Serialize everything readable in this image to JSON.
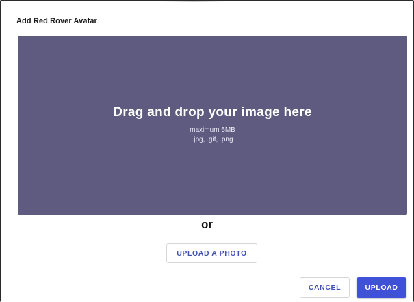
{
  "dialog": {
    "title": "Add Red Rover Avatar"
  },
  "dropzone": {
    "heading": "Drag and drop your image here",
    "max_size": "maximum 5MB",
    "file_types": ".jpg, .gif, .png",
    "background_color": "#5f5b80"
  },
  "divider": {
    "label": "or"
  },
  "actions": {
    "upload_photo_label": "UPLOAD A PHOTO",
    "cancel_label": "CANCEL",
    "upload_label": "UPLOAD",
    "accent_color": "#3f51d6"
  }
}
